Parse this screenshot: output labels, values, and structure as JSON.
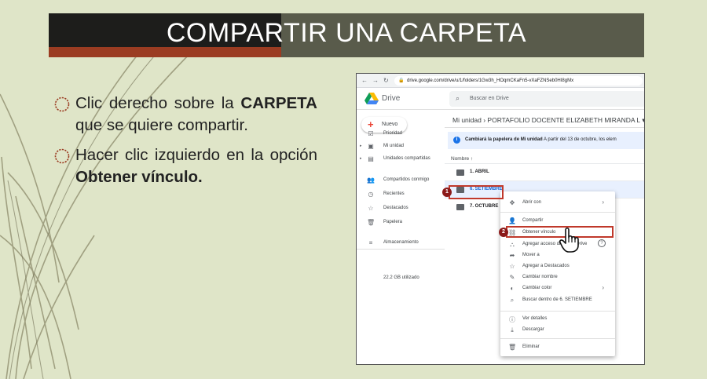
{
  "slide": {
    "title": "COMPARTIR UNA CARPETA",
    "bullets": [
      {
        "parts": [
          {
            "text": "Clic derecho sobre la ",
            "bold": false
          },
          {
            "text": "CARPETA",
            "bold": true
          },
          {
            "text": " que se quiere compartir.",
            "bold": false
          }
        ]
      },
      {
        "parts": [
          {
            "text": "Hacer clic izquierdo en la opción ",
            "bold": false
          },
          {
            "text": "Obtener vínculo.",
            "bold": true
          }
        ]
      }
    ],
    "colors": {
      "background": "#dfe5c8",
      "title_bar": "#595b4b",
      "title_dark": "#1d1d1b",
      "accent": "#9b3c22",
      "highlight": "#c0392b"
    }
  },
  "browser": {
    "url": "drive.google.com/drive/u/1/folders/1Gw3h_HOqmCKaFn5-vXaFZNSeb0HI8gMx"
  },
  "drive": {
    "app_name": "Drive",
    "search_placeholder": "Buscar en Drive",
    "new_button": "Nuevo",
    "sidebar": [
      {
        "icon": "priority-icon",
        "glyph": "☑",
        "label": "Prioridad"
      },
      {
        "icon": "my-drive-icon",
        "glyph": "▣",
        "label": "Mi unidad",
        "expandable": true
      },
      {
        "icon": "shared-drives-icon",
        "glyph": "▤",
        "label": "Unidades compartidas",
        "expandable": true
      },
      {
        "icon": "shared-with-me-icon",
        "glyph": "👥",
        "label": "Compartidos conmigo"
      },
      {
        "icon": "recent-icon",
        "glyph": "◷",
        "label": "Recientes"
      },
      {
        "icon": "starred-icon",
        "glyph": "☆",
        "label": "Destacados"
      },
      {
        "icon": "trash-icon",
        "glyph": "🗑",
        "label": "Papelera"
      },
      {
        "icon": "storage-icon",
        "glyph": "≡",
        "label": "Almacenamiento"
      }
    ],
    "storage_used": "22.2 GB utilizado",
    "breadcrumb": "Mi unidad  ›  PORTAFOLIO DOCENTE ELIZABETH MIRANDA L  ▾",
    "banner_bold": "Cambiará la papelera de Mi unidad",
    "banner_text": " A partir del 13 de octubre, los elem",
    "column_header": "Nombre  ↑",
    "folders": [
      {
        "name": "1. ABRIL",
        "selected": false
      },
      {
        "name": "6. SETIEMBRE",
        "selected": true
      },
      {
        "name": "7. OCTUBRE",
        "selected": false
      }
    ],
    "context_menu": [
      {
        "icon": "open-with-icon",
        "glyph": "✥",
        "label": "Abrir con",
        "submenu": true
      },
      {
        "icon": "share-icon",
        "glyph": "👤",
        "label": "Compartir"
      },
      {
        "icon": "link-icon",
        "glyph": "⛓",
        "label": "Obtener vínculo"
      },
      {
        "icon": "add-shortcut-icon",
        "glyph": "⛬",
        "label": "Agregar acceso directo a Drive"
      },
      {
        "icon": "move-icon",
        "glyph": "➦",
        "label": "Mover a"
      },
      {
        "icon": "star-icon",
        "glyph": "☆",
        "label": "Agregar a Destacados"
      },
      {
        "icon": "rename-icon",
        "glyph": "✎",
        "label": "Cambiar nombre"
      },
      {
        "icon": "color-icon",
        "glyph": "◐",
        "label": "Cambiar color",
        "submenu": true
      },
      {
        "icon": "search-icon",
        "glyph": "⌕",
        "label": "Buscar dentro de 6. SETIEMBRE"
      },
      {
        "icon": "details-icon",
        "glyph": "ⓘ",
        "label": "Ver detalles"
      },
      {
        "icon": "download-icon",
        "glyph": "⤓",
        "label": "Descargar"
      },
      {
        "icon": "delete-icon",
        "glyph": "🗑",
        "label": "Eliminar"
      }
    ],
    "step_numbers": [
      "1",
      "2"
    ]
  }
}
